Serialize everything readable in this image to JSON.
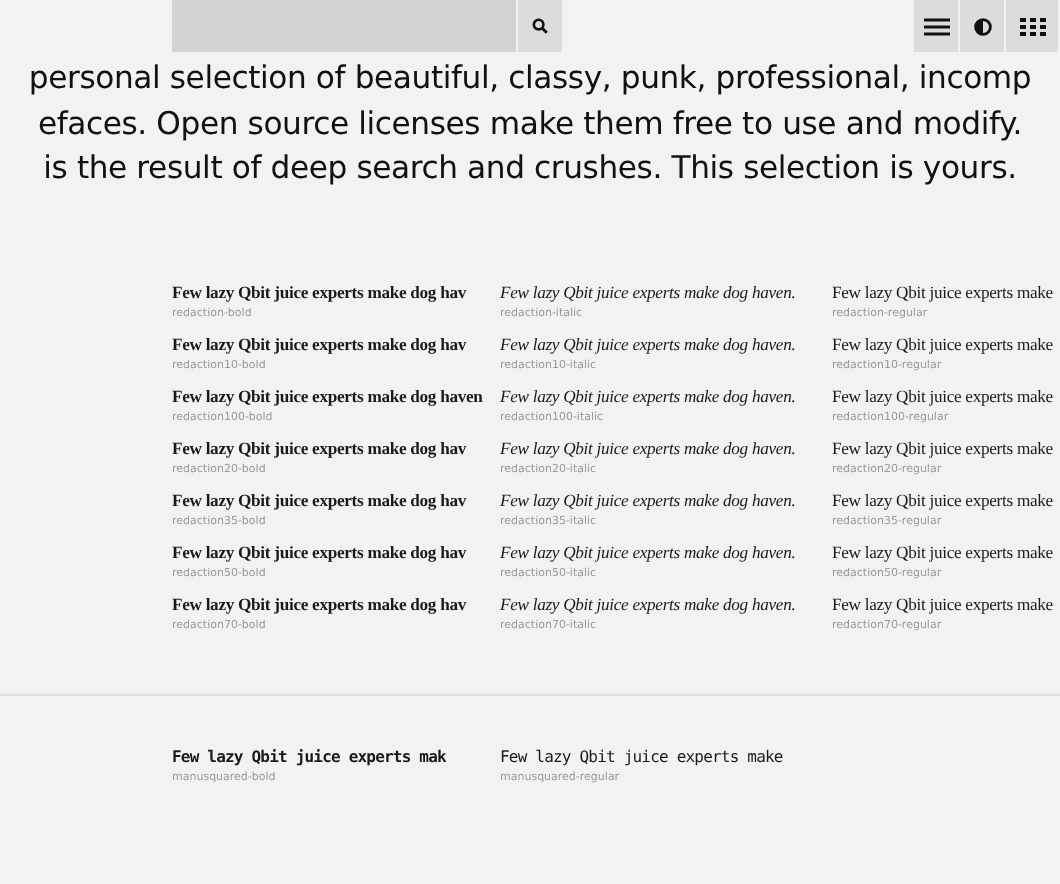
{
  "toolbar": {
    "search_button": {
      "kind": "search"
    },
    "buttons": [
      {
        "kind": "menu"
      },
      {
        "kind": "contrast"
      },
      {
        "kind": "grid"
      }
    ]
  },
  "intro": [
    "personal selection of beautiful, classy, punk, professional, incomp",
    "efaces. Open source licenses make them free to use and modify.",
    "is the result of deep search and crushes. This selection is yours."
  ],
  "sections": [
    {
      "kind": "serif",
      "cells": [
        {
          "kind": "bold",
          "sample": "Few lazy Qbit juice experts make dog hav",
          "name": "redaction-bold"
        },
        {
          "kind": "italic",
          "sample": "Few lazy Qbit juice experts make dog haven.",
          "name": "redaction-italic"
        },
        {
          "kind": "regular",
          "sample": "Few lazy Qbit juice experts make",
          "name": "redaction-regular"
        },
        {
          "kind": "bold",
          "sample": "Few lazy Qbit juice experts make dog hav",
          "name": "redaction10-bold"
        },
        {
          "kind": "italic",
          "sample": "Few lazy Qbit juice experts make dog haven.",
          "name": "redaction10-italic"
        },
        {
          "kind": "regular",
          "sample": "Few lazy Qbit juice experts make",
          "name": "redaction10-regular"
        },
        {
          "kind": "bold",
          "sample": "Few lazy Qbit juice experts make dog haven",
          "name": "redaction100-bold"
        },
        {
          "kind": "italic",
          "sample": "Few lazy Qbit juice experts make dog haven.",
          "name": "redaction100-italic"
        },
        {
          "kind": "regular",
          "sample": "Few lazy Qbit juice experts make",
          "name": "redaction100-regular"
        },
        {
          "kind": "bold",
          "sample": "Few lazy Qbit juice experts make dog hav",
          "name": "redaction20-bold"
        },
        {
          "kind": "italic",
          "sample": "Few lazy Qbit juice experts make dog haven.",
          "name": "redaction20-italic"
        },
        {
          "kind": "regular",
          "sample": "Few lazy Qbit juice experts make",
          "name": "redaction20-regular"
        },
        {
          "kind": "bold",
          "sample": "Few lazy Qbit juice experts make dog hav",
          "name": "redaction35-bold"
        },
        {
          "kind": "italic",
          "sample": "Few lazy Qbit juice experts make dog haven.",
          "name": "redaction35-italic"
        },
        {
          "kind": "regular",
          "sample": "Few lazy Qbit juice experts make",
          "name": "redaction35-regular"
        },
        {
          "kind": "bold",
          "sample": "Few lazy Qbit juice experts make dog hav",
          "name": "redaction50-bold"
        },
        {
          "kind": "italic",
          "sample": "Few lazy Qbit juice experts make dog haven.",
          "name": "redaction50-italic"
        },
        {
          "kind": "regular",
          "sample": "Few lazy Qbit juice experts make",
          "name": "redaction50-regular"
        },
        {
          "kind": "bold",
          "sample": "Few lazy Qbit juice experts make dog hav",
          "name": "redaction70-bold"
        },
        {
          "kind": "italic",
          "sample": "Few lazy Qbit juice experts make dog haven.",
          "name": "redaction70-italic"
        },
        {
          "kind": "regular",
          "sample": "Few lazy Qbit juice experts make",
          "name": "redaction70-regular"
        }
      ]
    },
    {
      "kind": "pixel",
      "cells": [
        {
          "kind": "bold",
          "sample": "Few lazy Qbit juice experts mak",
          "name": "manusquared-bold"
        },
        {
          "kind": "regular",
          "sample": "Few lazy Qbit juice experts make",
          "name": "manusquared-regular"
        }
      ]
    }
  ]
}
